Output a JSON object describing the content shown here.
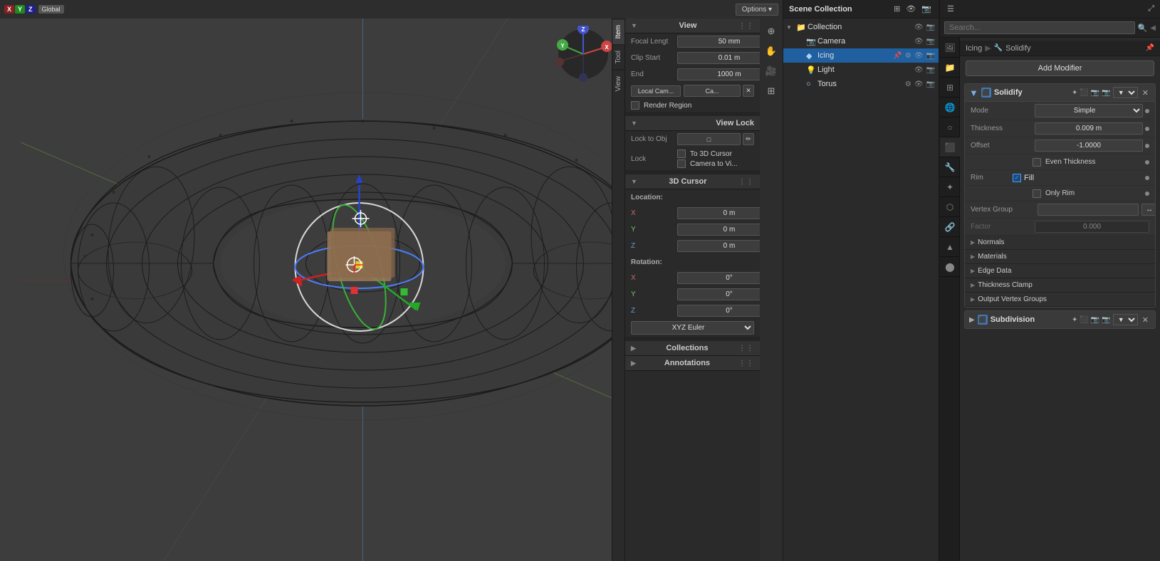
{
  "viewport": {
    "topbar": {
      "xyz_x": "X",
      "xyz_y": "Y",
      "xyz_z": "Z",
      "global_label": "Global",
      "options_label": "Options ▾"
    },
    "tabs": [
      "Item",
      "Tool",
      "View"
    ]
  },
  "npanel": {
    "view_section": "View",
    "focal_length_label": "Focal Lengt",
    "focal_length_value": "50 mm",
    "clip_start_label": "Clip Start",
    "clip_start_value": "0.01 m",
    "end_label": "End",
    "end_value": "1000 m",
    "local_cam_label": "Local Cam...",
    "cam_label": "Ca...",
    "render_region_label": "Render Region",
    "view_lock_section": "View Lock",
    "lock_to_obj_label": "Lock to Obj",
    "lock_label": "Lock",
    "to_3d_cursor_label": "To 3D Cursor",
    "camera_to_vi_label": "Camera to Vi...",
    "cursor_section": "3D Cursor",
    "location_label": "Location:",
    "loc_x_label": "X",
    "loc_x_value": "0 m",
    "loc_y_label": "Y",
    "loc_y_value": "0 m",
    "loc_z_label": "Z",
    "loc_z_value": "0 m",
    "rotation_label": "Rotation:",
    "rot_x_label": "X",
    "rot_x_value": "0°",
    "rot_y_label": "Y",
    "rot_y_value": "0°",
    "rot_z_label": "Z",
    "rot_z_value": "0°",
    "xyz_euler_label": "XYZ Euler",
    "collections_label": "Collections",
    "annotations_label": "Annotations"
  },
  "outliner": {
    "title": "Scene Collection",
    "items": [
      {
        "indent": 0,
        "type": "collection",
        "label": "Collection",
        "icon": "📁",
        "has_arrow": true,
        "expanded": true
      },
      {
        "indent": 1,
        "type": "camera",
        "label": "Camera",
        "icon": "📷",
        "has_arrow": false
      },
      {
        "indent": 1,
        "type": "object",
        "label": "Icing",
        "icon": "◆",
        "has_arrow": false,
        "selected": true,
        "active": true
      },
      {
        "indent": 1,
        "type": "light",
        "label": "Light",
        "icon": "💡",
        "has_arrow": false
      },
      {
        "indent": 1,
        "type": "torus",
        "label": "Torus",
        "icon": "○",
        "has_arrow": false
      }
    ]
  },
  "properties": {
    "breadcrumb_object": "Icing",
    "breadcrumb_modifier": "Solidify",
    "add_modifier_label": "Add Modifier",
    "modifier1": {
      "name": "Solidify",
      "mode_label": "Mode",
      "mode_value": "Simple",
      "thickness_label": "Thickness",
      "thickness_value": "0.009 m",
      "offset_label": "Offset",
      "offset_value": "-1.0000",
      "even_thickness_label": "Even Thickness",
      "rim_label": "Rim",
      "fill_checked": true,
      "fill_label": "Fill",
      "only_rim_label": "Only Rim",
      "vertex_group_label": "Vertex Group",
      "vertex_group_value": "",
      "arrow_symbol": "↔",
      "factor_label": "Factor",
      "factor_value": "0.000",
      "normals_label": "Normals",
      "materials_label": "Materials",
      "edge_data_label": "Edge Data",
      "thickness_clamp_label": "Thickness Clamp",
      "output_vertex_groups_label": "Output Vertex Groups"
    },
    "modifier2": {
      "name": "Subdivision"
    }
  }
}
